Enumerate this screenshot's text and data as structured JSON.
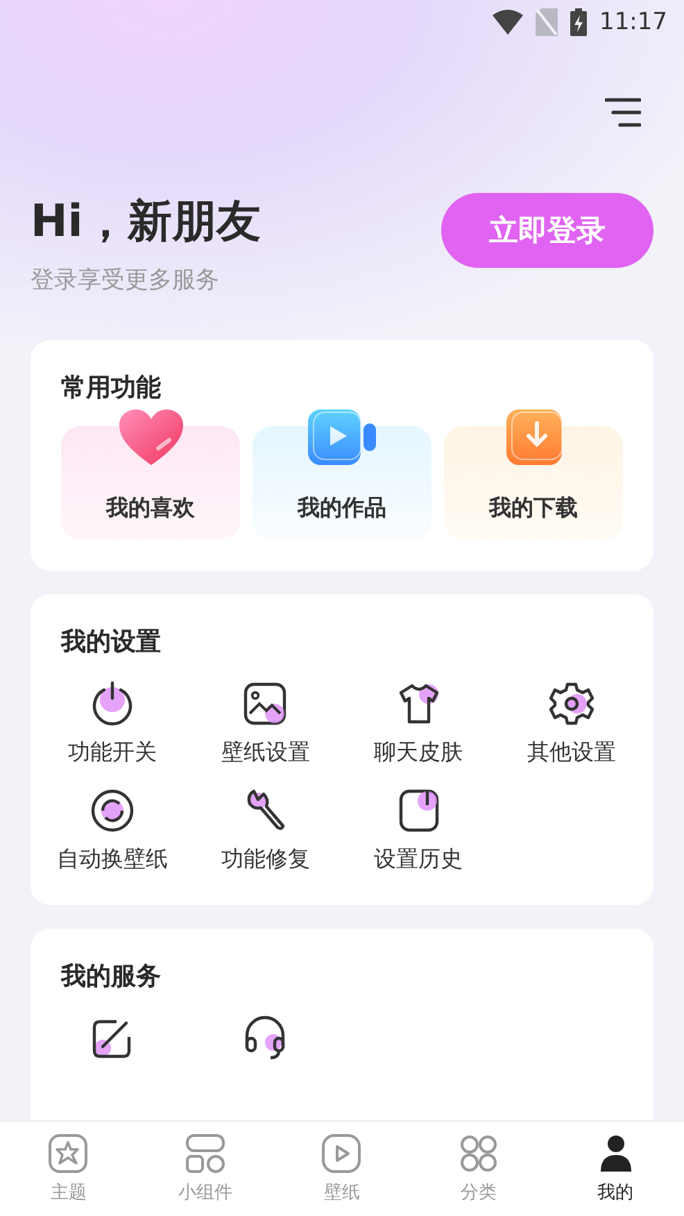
{
  "status_bar": {
    "time": "11:17"
  },
  "header": {
    "greeting": "Hi，新朋友",
    "subtitle": "登录享受更多服务",
    "login_button": "立即登录"
  },
  "common_functions": {
    "title": "常用功能",
    "items": [
      {
        "label": "我的喜欢",
        "kind": "heart"
      },
      {
        "label": "我的作品",
        "kind": "video"
      },
      {
        "label": "我的下载",
        "kind": "download"
      }
    ]
  },
  "settings": {
    "title": "我的设置",
    "items": [
      {
        "label": "功能开关",
        "kind": "power"
      },
      {
        "label": "壁纸设置",
        "kind": "image"
      },
      {
        "label": "聊天皮肤",
        "kind": "shirt"
      },
      {
        "label": "其他设置",
        "kind": "gear"
      },
      {
        "label": "自动换壁纸",
        "kind": "cycle"
      },
      {
        "label": "功能修复",
        "kind": "wrench"
      },
      {
        "label": "设置历史",
        "kind": "history"
      }
    ]
  },
  "services": {
    "title": "我的服务",
    "items": [
      {
        "kind": "edit"
      },
      {
        "kind": "headset"
      }
    ]
  },
  "bottom_nav": [
    {
      "label": "主题",
      "kind": "theme",
      "selected": false
    },
    {
      "label": "小组件",
      "kind": "widget",
      "selected": false
    },
    {
      "label": "壁纸",
      "kind": "play",
      "selected": false
    },
    {
      "label": "分类",
      "kind": "grid",
      "selected": false
    },
    {
      "label": "我的",
      "kind": "person",
      "selected": true
    }
  ]
}
